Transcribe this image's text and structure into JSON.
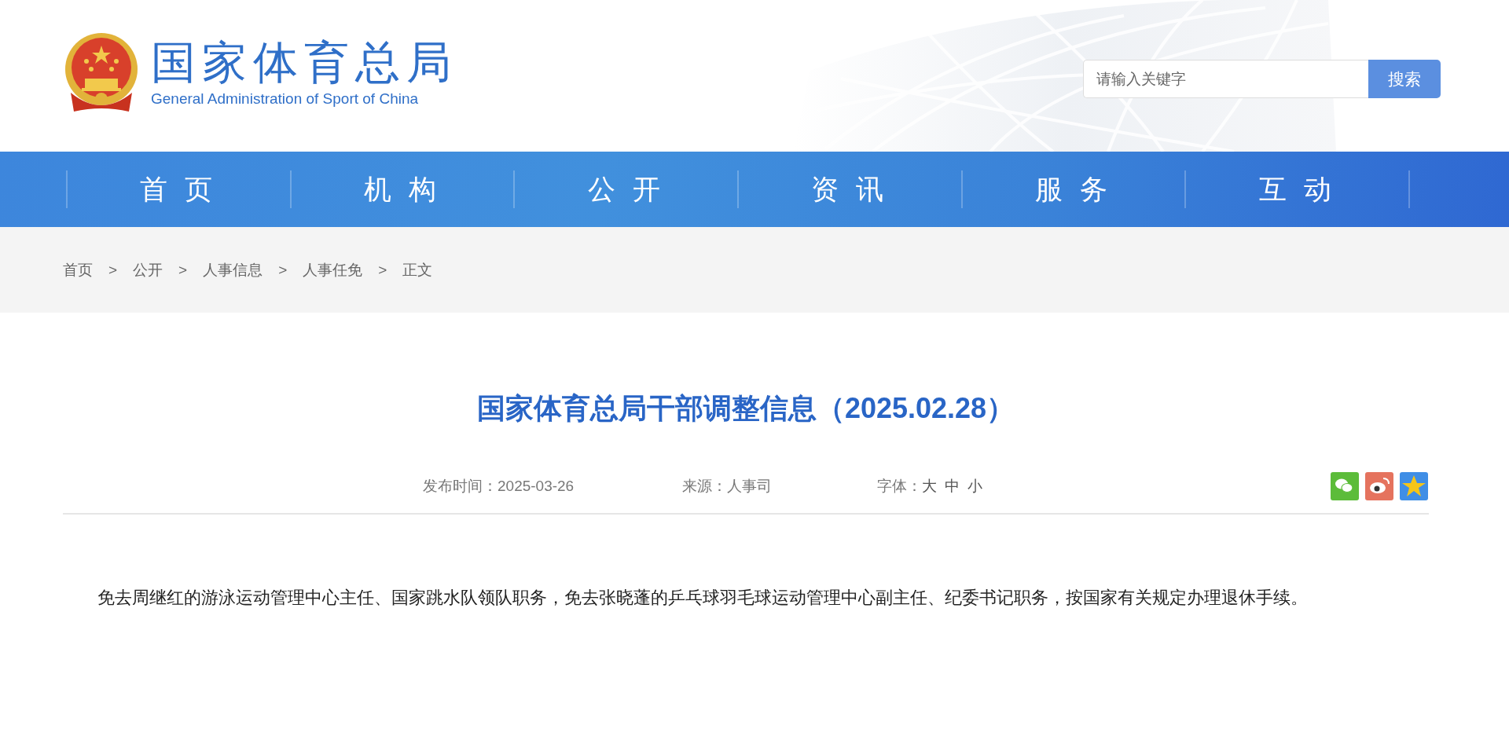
{
  "header": {
    "title_cn": "国家体育总局",
    "title_en": "General Administration of Sport of China",
    "search": {
      "placeholder": "请输入关键字",
      "button": "搜索"
    }
  },
  "nav": [
    {
      "label": "首 页"
    },
    {
      "label": "机 构"
    },
    {
      "label": "公 开"
    },
    {
      "label": "资 讯"
    },
    {
      "label": "服 务"
    },
    {
      "label": "互 动"
    }
  ],
  "breadcrumb": {
    "separator": ">",
    "items": [
      "首页",
      "公开",
      "人事信息",
      "人事任免",
      "正文"
    ]
  },
  "article": {
    "title": "国家体育总局干部调整信息（2025.02.28）",
    "meta": {
      "date_label": "发布时间：",
      "date": "2025-03-26",
      "source_label": "来源：",
      "source": "人事司",
      "font_label": "字体：",
      "font_sizes": [
        "大",
        "中",
        "小"
      ]
    },
    "share": [
      {
        "kind": "wechat"
      },
      {
        "kind": "weibo"
      },
      {
        "kind": "qzone"
      }
    ],
    "body": "免去周继红的游泳运动管理中心主任、国家跳水队领队职务，免去张晓蓬的乒乓球羽毛球运动管理中心副主任、纪委书记职务，按国家有关规定办理退休手续。"
  }
}
